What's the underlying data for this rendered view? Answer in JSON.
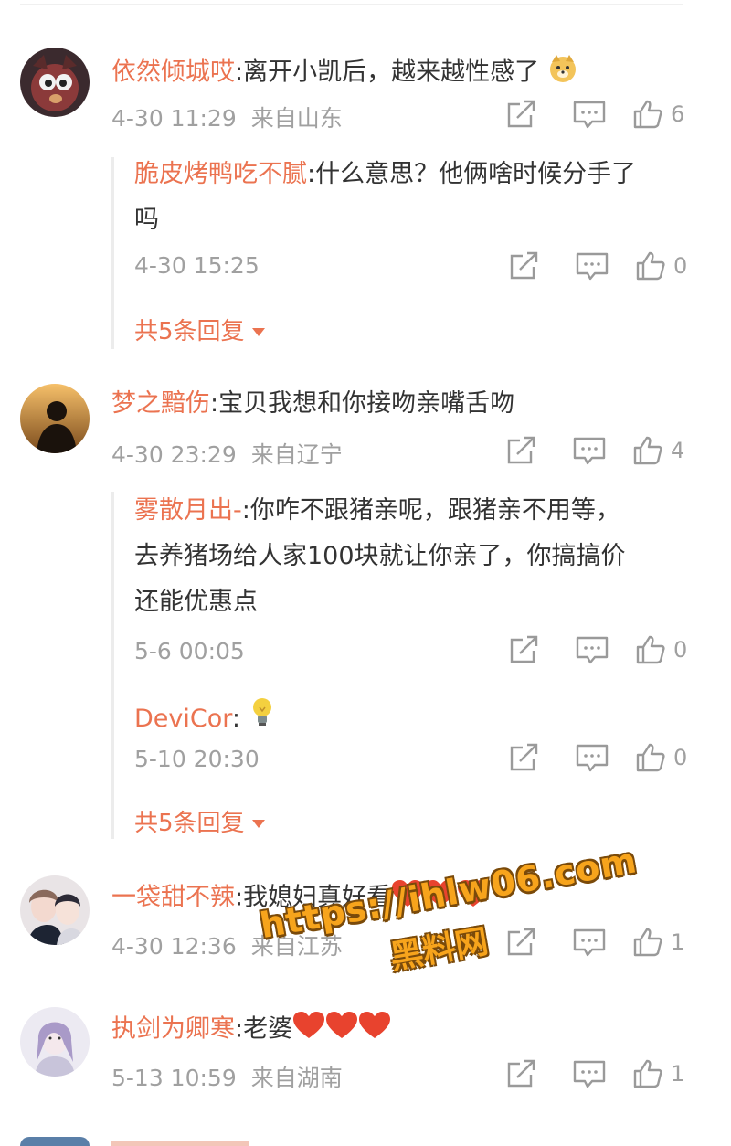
{
  "colors": {
    "username": "#eb7350",
    "meta": "#a0a0a0",
    "text": "#333333",
    "heart": "#e8432e"
  },
  "comments": [
    {
      "user": "依然倾城哎",
      "text": "离开小凯后，越来越性感了",
      "emoji": "doge-emoji",
      "time": "4-30 11:29",
      "location": "来自山东",
      "likes": "6",
      "replies": [
        {
          "user": "脆皮烤鸭吃不腻",
          "text_line1": "什么意思？他俩啥时候分手了",
          "text_line2": "吗",
          "time": "4-30 15:25",
          "likes": "0"
        }
      ],
      "more": "共5条回复"
    },
    {
      "user": "梦之黯伤",
      "text": "宝贝我想和你接吻亲嘴舌吻",
      "time": "4-30 23:29",
      "location": "来自辽宁",
      "likes": "4",
      "replies": [
        {
          "user": "雾散月出-",
          "text_line1": "你咋不跟猪亲呢，跟猪亲不用等，",
          "text_line2": "去养猪场给人家100块就让你亲了，你搞搞价",
          "text_line3": "还能优惠点",
          "time": "5-6 00:05",
          "likes": "0"
        },
        {
          "user": "DeviCor",
          "emoji": "lightbulb-emoji",
          "time": "5-10 20:30",
          "likes": "0"
        }
      ],
      "more": "共5条回复"
    },
    {
      "user": "一袋甜不辣",
      "text": "我媳妇真好看",
      "time": "4-30 12:36",
      "location": "来自江苏",
      "likes": "1"
    },
    {
      "user": "执剑为卿寒",
      "text": "老婆",
      "time": "5-13 10:59",
      "location": "来自湖南",
      "likes": "1"
    }
  ],
  "watermark": {
    "url": "https://ihlw06.com",
    "name": "黑料网"
  }
}
